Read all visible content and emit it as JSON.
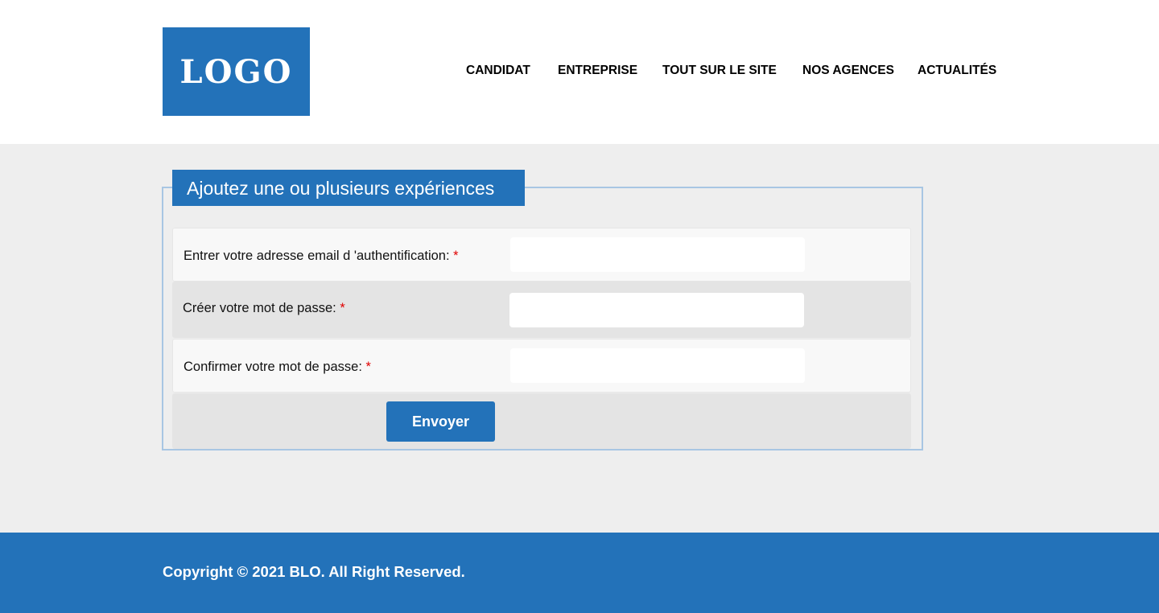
{
  "header": {
    "logo_text": "LOGO",
    "nav": [
      "CANDIDAT",
      "ENTREPRISE",
      "TOUT SUR LE SITE",
      "NOS AGENCES",
      "ACTUALITÉS"
    ]
  },
  "form": {
    "legend": "Ajoutez une ou plusieurs expériences",
    "fields": [
      {
        "label": "Entrer votre adresse email d 'authentification:",
        "required_mark": "*",
        "value": ""
      },
      {
        "label": "Créer votre mot de passe:",
        "required_mark": "*",
        "value": ""
      },
      {
        "label": "Confirmer votre mot de passe:",
        "required_mark": "*",
        "value": ""
      }
    ],
    "submit_label": "Envoyer"
  },
  "footer": {
    "copyright": "Copyright © 2021 BLO. All Right Reserved."
  },
  "colors": {
    "brand": "#2372b9",
    "background": "#eeeeee",
    "required": "#e00000"
  }
}
